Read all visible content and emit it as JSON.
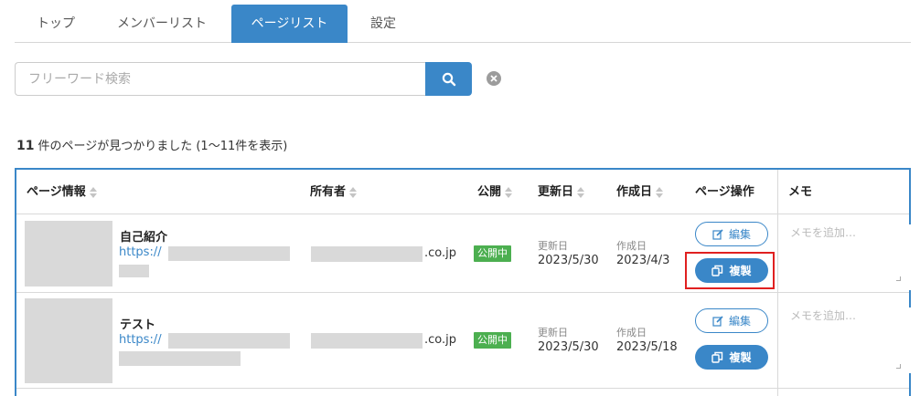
{
  "tabs": [
    {
      "label": "トップ",
      "active": false
    },
    {
      "label": "メンバーリスト",
      "active": false
    },
    {
      "label": "ページリスト",
      "active": true
    },
    {
      "label": "設定",
      "active": false
    }
  ],
  "search": {
    "placeholder": "フリーワード検索",
    "value": ""
  },
  "result": {
    "count": "11",
    "text": "件のページが見つかりました (1〜11件を表示)"
  },
  "table": {
    "headers": {
      "page_info": "ページ情報",
      "owner": "所有者",
      "public": "公開",
      "updated": "更新日",
      "created": "作成日",
      "page_ops": "ページ操作",
      "memo": "メモ"
    },
    "rows": [
      {
        "title": "自己紹介",
        "url_prefix": "https://",
        "owner_suffix": ".co.jp",
        "status": "公開中",
        "updated_label": "更新日",
        "updated": "2023/5/30",
        "created_label": "作成日",
        "created": "2023/4/3",
        "edit_label": "編集",
        "copy_label": "複製",
        "memo_placeholder": "メモを追加…"
      },
      {
        "title": "テスト",
        "url_prefix": "https://",
        "owner_suffix": ".co.jp",
        "status": "公開中",
        "updated_label": "更新日",
        "updated": "2023/5/30",
        "created_label": "作成日",
        "created": "2023/5/18",
        "edit_label": "編集",
        "copy_label": "複製",
        "memo_placeholder": "メモを追加…"
      }
    ]
  },
  "colors": {
    "accent": "#3a87c8",
    "status_green": "#4caf50",
    "highlight_red": "#e02020"
  },
  "icons": [
    "search-icon",
    "clear-icon",
    "edit-icon",
    "copy-icon",
    "sort-icon"
  ]
}
